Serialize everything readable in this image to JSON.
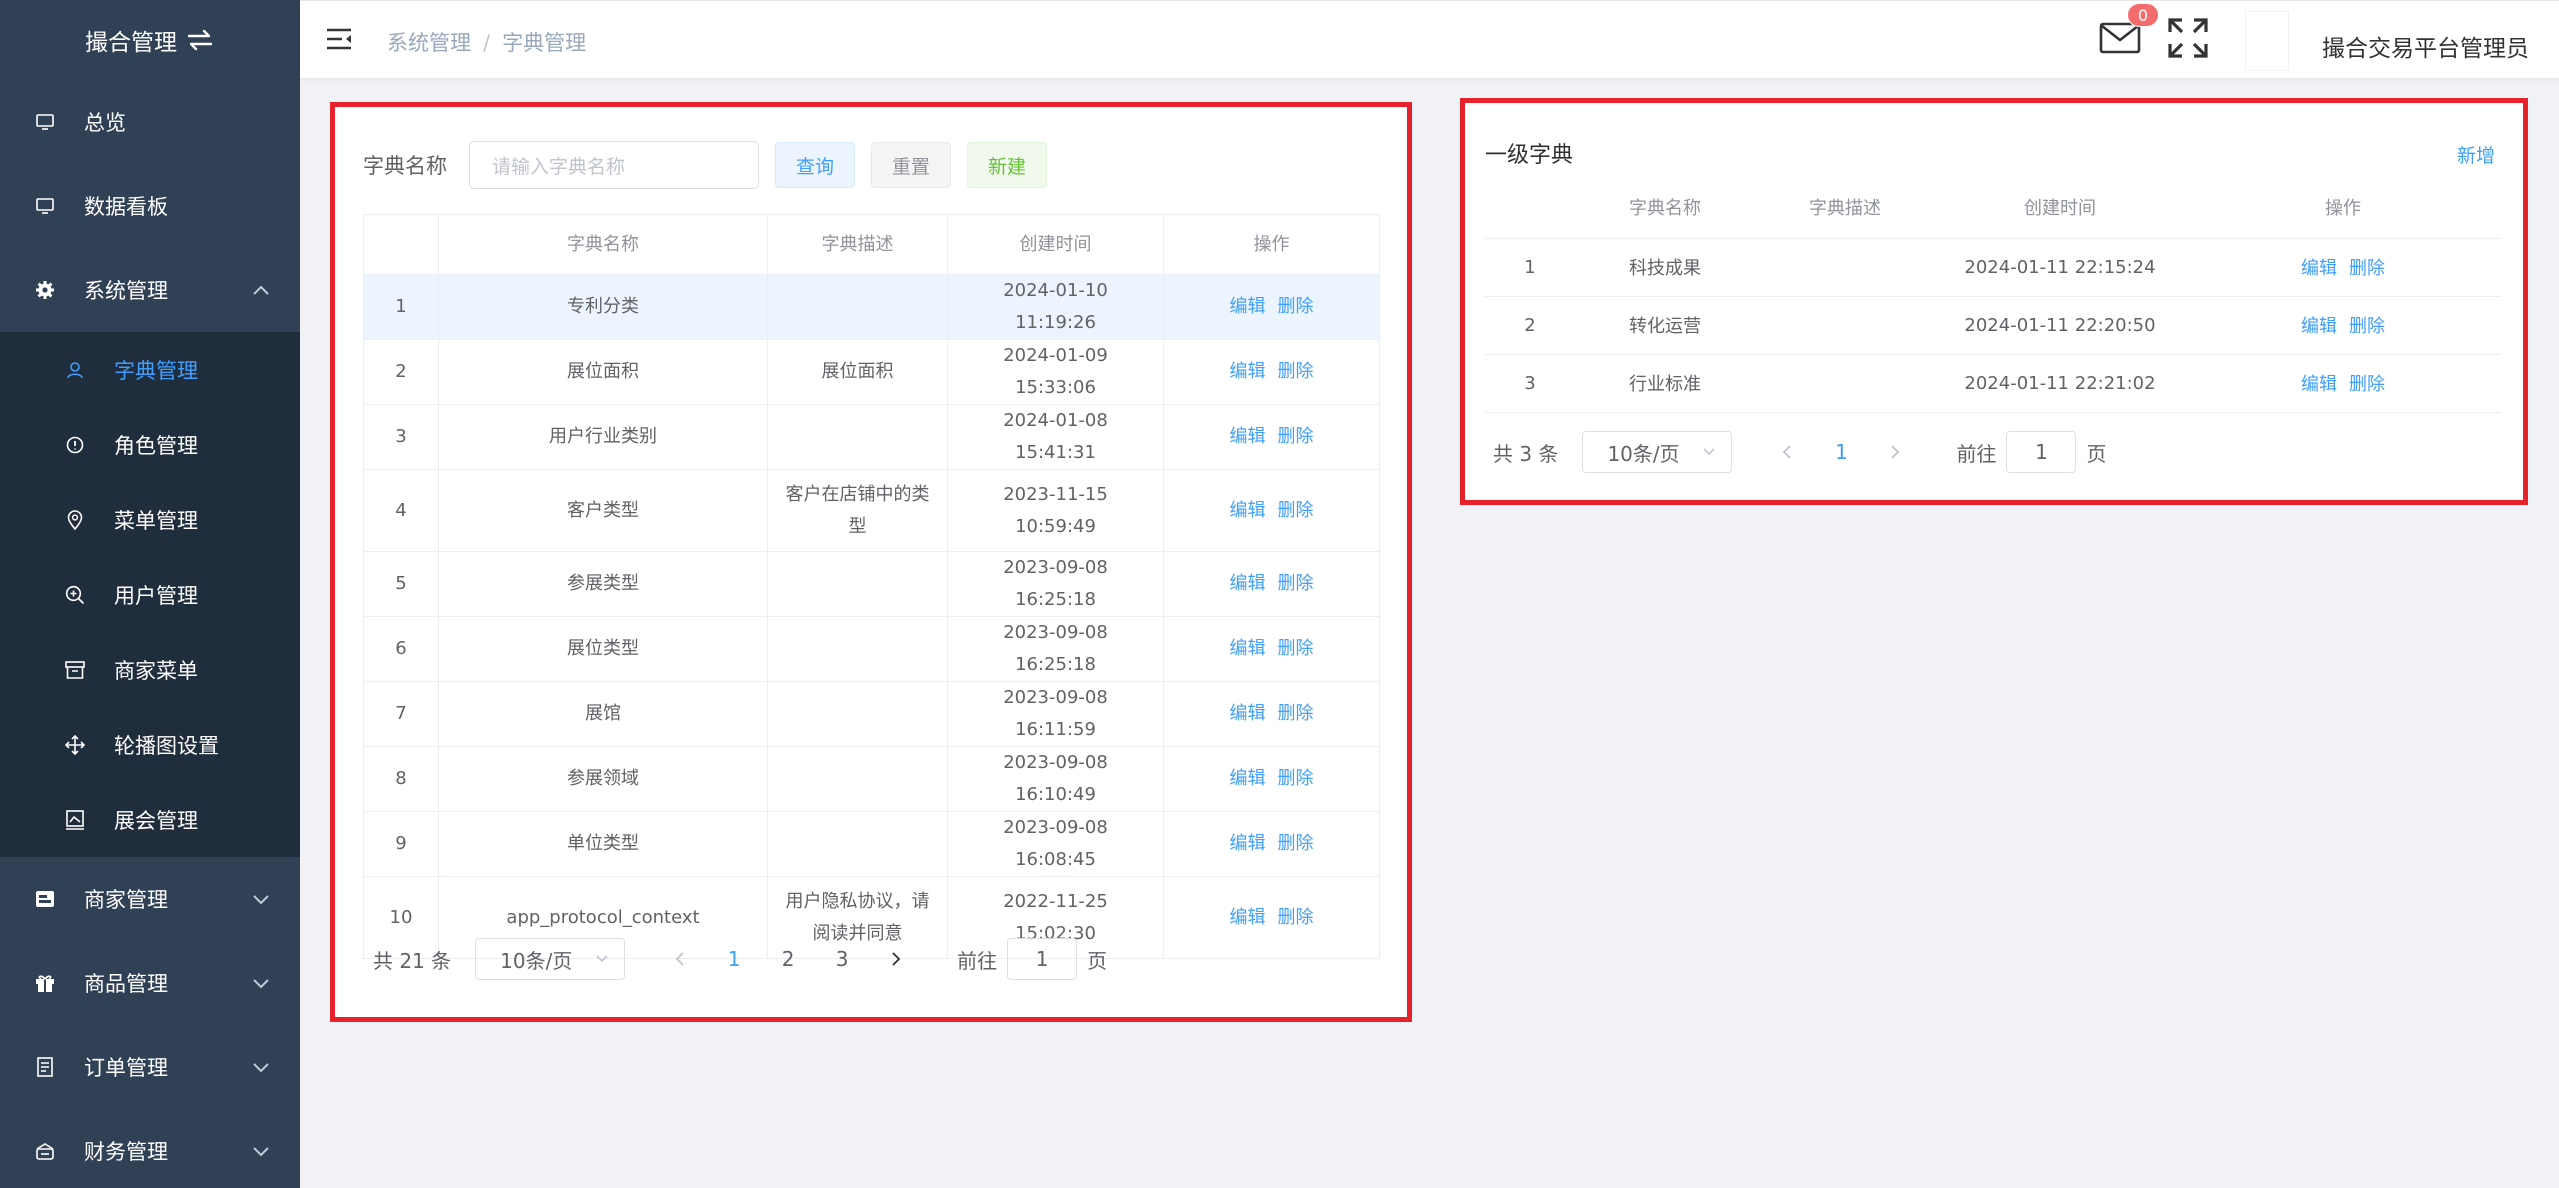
{
  "sidebar": {
    "title": "撮合管理",
    "menu": [
      {
        "label": "总览"
      },
      {
        "label": "数据看板"
      },
      {
        "label": "系统管理"
      }
    ],
    "submenu": [
      {
        "label": "字典管理"
      },
      {
        "label": "角色管理"
      },
      {
        "label": "菜单管理"
      },
      {
        "label": "用户管理"
      },
      {
        "label": "商家菜单"
      },
      {
        "label": "轮播图设置"
      },
      {
        "label": "展会管理"
      }
    ],
    "menu2": [
      {
        "label": "商家管理"
      },
      {
        "label": "商品管理"
      },
      {
        "label": "订单管理"
      },
      {
        "label": "财务管理"
      }
    ]
  },
  "header": {
    "breadcrumb": [
      "系统管理",
      "字典管理"
    ],
    "breadcrumb_sep": "/",
    "mail_badge": "0",
    "admin_name": "撮合交易平台管理员"
  },
  "search": {
    "label": "字典名称",
    "placeholder": "请输入字典名称",
    "query": "查询",
    "reset": "重置",
    "new": "新建"
  },
  "left_table": {
    "columns": [
      "",
      "字典名称",
      "字典描述",
      "创建时间",
      "操作"
    ],
    "rows": [
      {
        "idx": "1",
        "name": "专利分类",
        "desc": "",
        "time": "2024-01-10 11:19:26"
      },
      {
        "idx": "2",
        "name": "展位面积",
        "desc": "展位面积",
        "time": "2024-01-09 15:33:06"
      },
      {
        "idx": "3",
        "name": "用户行业类别",
        "desc": "",
        "time": "2024-01-08 15:41:31"
      },
      {
        "idx": "4",
        "name": "客户类型",
        "desc": "客户在店铺中的类型",
        "time": "2023-11-15 10:59:49"
      },
      {
        "idx": "5",
        "name": "参展类型",
        "desc": "",
        "time": "2023-09-08 16:25:18"
      },
      {
        "idx": "6",
        "name": "展位类型",
        "desc": "",
        "time": "2023-09-08 16:25:18"
      },
      {
        "idx": "7",
        "name": "展馆",
        "desc": "",
        "time": "2023-09-08 16:11:59"
      },
      {
        "idx": "8",
        "name": "参展领域",
        "desc": "",
        "time": "2023-09-08 16:10:49"
      },
      {
        "idx": "9",
        "name": "单位类型",
        "desc": "",
        "time": "2023-09-08 16:08:45"
      },
      {
        "idx": "10",
        "name": "app_protocol_context",
        "desc": "用户隐私协议，请阅读并同意",
        "time": "2022-11-25 15:02:30"
      }
    ],
    "edit": "编辑",
    "delete": "删除"
  },
  "left_pager": {
    "total": "共 21 条",
    "size": "10条/页",
    "pages": [
      "1",
      "2",
      "3"
    ],
    "goto_prefix": "前往",
    "goto_value": "1",
    "goto_suffix": "页"
  },
  "right_card": {
    "title": "一级字典",
    "add": "新增",
    "columns": [
      "",
      "字典名称",
      "字典描述",
      "创建时间",
      "操作"
    ],
    "rows": [
      {
        "idx": "1",
        "name": "科技成果",
        "desc": "",
        "time": "2024-01-11 22:15:24"
      },
      {
        "idx": "2",
        "name": "转化运营",
        "desc": "",
        "time": "2024-01-11 22:20:50"
      },
      {
        "idx": "3",
        "name": "行业标准",
        "desc": "",
        "time": "2024-01-11 22:21:02"
      }
    ],
    "edit": "编辑",
    "delete": "删除"
  },
  "right_pager": {
    "total": "共 3 条",
    "size": "10条/页",
    "pages": [
      "1"
    ],
    "goto_prefix": "前往",
    "goto_value": "1",
    "goto_suffix": "页"
  },
  "colors": {
    "sidebar_bg": "#304156",
    "submenu_bg": "#1f2d3d",
    "accent": "#409eff",
    "highlight_border": "#e8222c",
    "badge": "#f56c6c"
  }
}
